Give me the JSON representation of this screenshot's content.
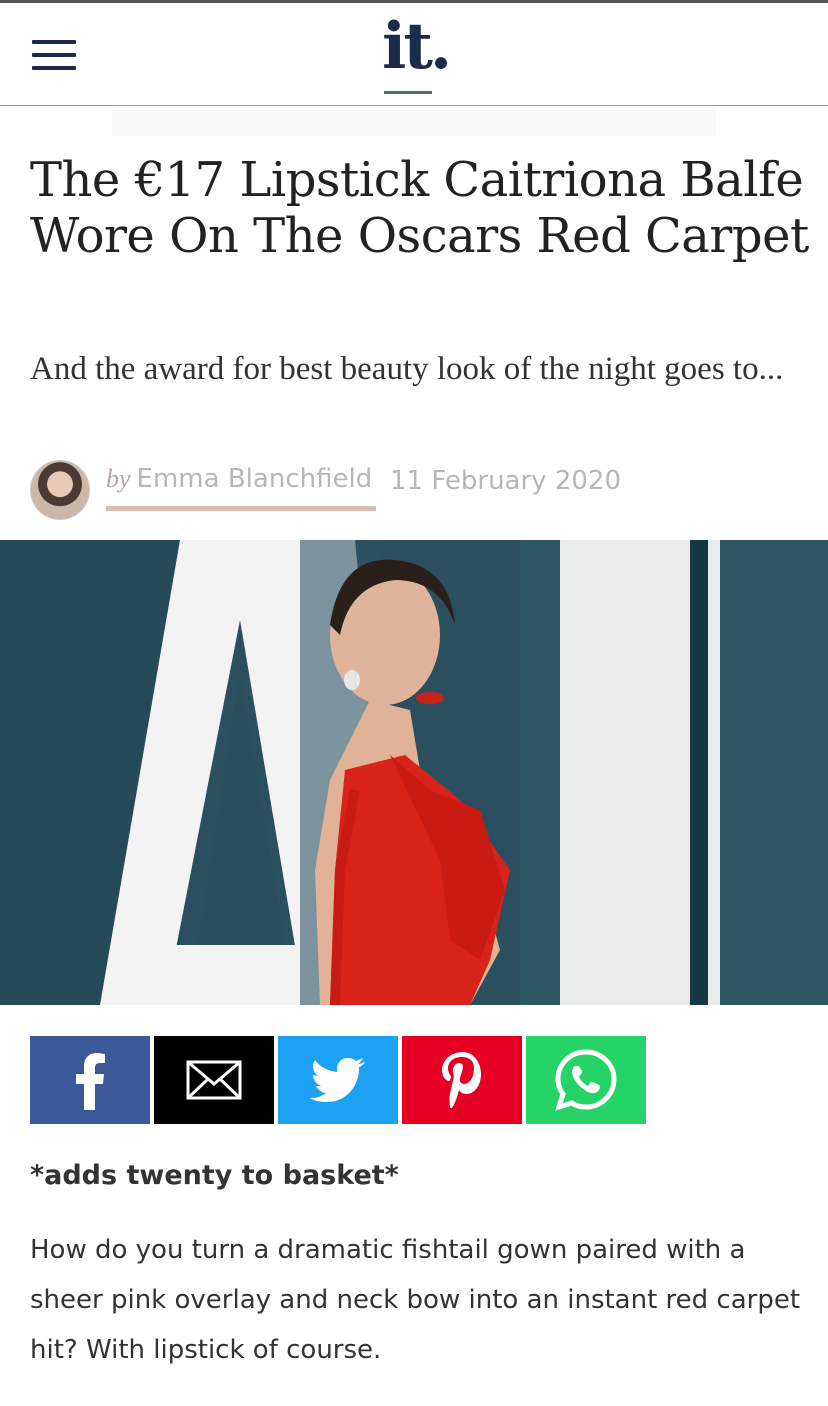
{
  "header": {
    "logo_text": "it.",
    "menu_icon": "hamburger-menu-icon"
  },
  "article": {
    "title": "The €17 Lipstick Caitriona Balfe Wore On The Oscars Red Carpet",
    "standfirst": "And the award for best beauty look of the night goes to...",
    "byline": {
      "by": "by",
      "author": "Emma Blanchfield",
      "date": "11 February 2020"
    },
    "lead": "*adds twenty to basket*",
    "body": "How do you turn a dramatic fishtail gown paired with a sheer pink overlay and neck bow into an instant red carpet hit? With lipstick of course."
  },
  "share": [
    {
      "network": "facebook",
      "icon": "facebook-icon",
      "color": "#3b5998"
    },
    {
      "network": "email",
      "icon": "email-icon",
      "color": "#000000"
    },
    {
      "network": "twitter",
      "icon": "twitter-icon",
      "color": "#1da1f2"
    },
    {
      "network": "pinterest",
      "icon": "pinterest-icon",
      "color": "#e60023"
    },
    {
      "network": "whatsapp",
      "icon": "whatsapp-icon",
      "color": "#25d366"
    }
  ],
  "colors": {
    "brand_navy": "#1c2b4a",
    "byline_underline": "#dcbbb3",
    "dress_red": "#d8221a"
  }
}
